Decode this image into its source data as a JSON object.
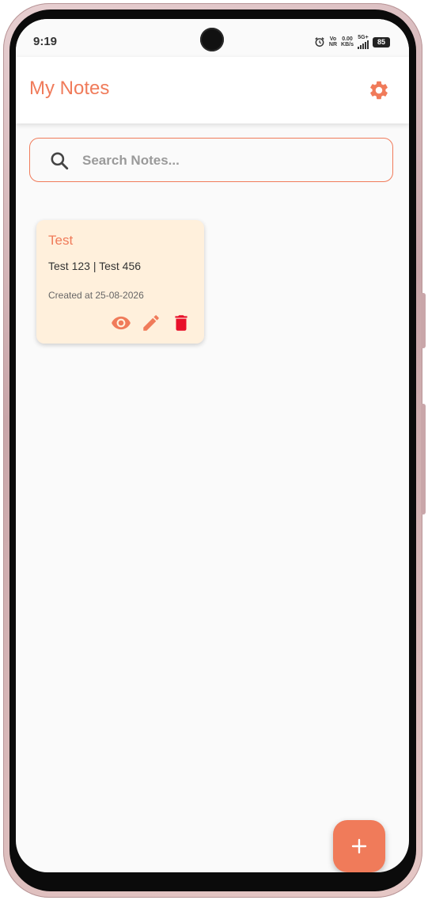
{
  "status_bar": {
    "time": "9:19",
    "network_top": "Vo",
    "network_bottom": "NR",
    "speed_top": "0.00",
    "speed_bottom": "KB/s",
    "signal_label": "5G+",
    "battery": "85"
  },
  "app_bar": {
    "title": "My Notes",
    "settings_icon": "gear-icon"
  },
  "search": {
    "placeholder": "Search Notes...",
    "value": "",
    "icon": "search-icon"
  },
  "notes": [
    {
      "title": "Test",
      "body": "Test 123 | Test 456",
      "created": "Created at 25-08-2026",
      "actions": [
        "eye-icon",
        "pencil-icon",
        "trash-icon"
      ]
    }
  ],
  "fab": {
    "icon": "plus-icon"
  },
  "colors": {
    "accent": "#f07b5a",
    "card_background": "#fff0dc",
    "delete": "#e8102a",
    "screen_background": "#fafafa"
  }
}
